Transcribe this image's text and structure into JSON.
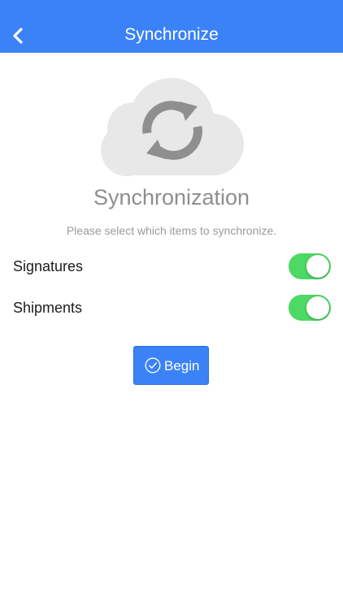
{
  "header": {
    "title": "Synchronize",
    "back_icon": "chevron-left-icon"
  },
  "hero": {
    "icon": "cloud-sync-icon",
    "title": "Synchronization",
    "subtitle": "Please select which items to synchronize."
  },
  "options": [
    {
      "label": "Signatures",
      "enabled": true
    },
    {
      "label": "Shipments",
      "enabled": true
    }
  ],
  "action": {
    "icon": "check-circle-icon",
    "label": "Begin"
  },
  "colors": {
    "header": "#3b82f6",
    "toggle_on": "#4cd964",
    "button": "#3b82f6",
    "cloud": "#e8e8e8",
    "sync_arrows": "#8f8f8f"
  }
}
